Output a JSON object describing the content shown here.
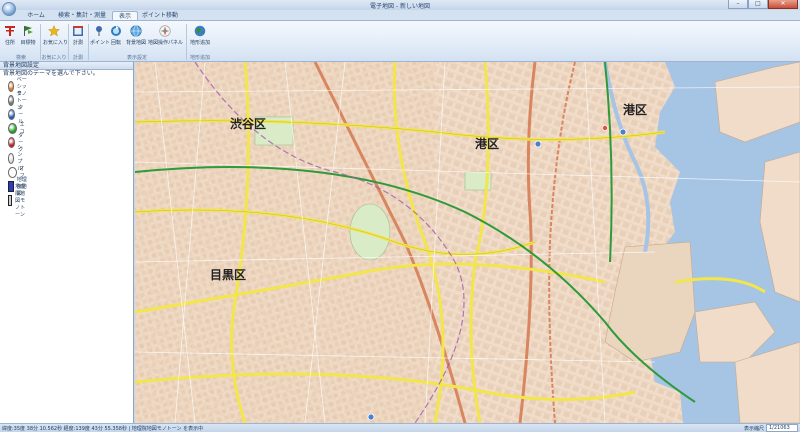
{
  "window": {
    "title": "電子地図 - 新しい地図",
    "minimize": "–",
    "maximize": "□",
    "close": "✕"
  },
  "tabs": [
    {
      "label": "ホーム"
    },
    {
      "label": "検索・集計・測量"
    },
    {
      "label": "表示"
    },
    {
      "label": "ポイント移動"
    }
  ],
  "ribbon": {
    "buttons": [
      {
        "label": "住所",
        "icon": "pin-icon",
        "color": "#c4271b"
      },
      {
        "label": "目標物",
        "icon": "flag-icon",
        "color": "#2f7d2f"
      },
      {
        "label": "お気に入り",
        "icon": "star-icon",
        "color": "#e8b81e"
      },
      {
        "label": "計測",
        "icon": "ruler-icon",
        "color": "#3b6cb0"
      },
      {
        "label": "ポイント",
        "icon": "pushpin-icon",
        "color": "#3b6cb0"
      },
      {
        "label": "回転",
        "icon": "rotate-icon",
        "color": "#2e7bc4"
      },
      {
        "label": "背景地図",
        "icon": "globe-icon",
        "color": "#2e7bc4"
      },
      {
        "label": "地図操作パネル",
        "icon": "compass-icon",
        "color": "#c04a3a"
      },
      {
        "label": "地形追加",
        "icon": "earth-icon",
        "color": "#3a8a3a"
      }
    ],
    "groups": [
      {
        "label": "検索"
      },
      {
        "label": "お気に入り"
      },
      {
        "label": "計測"
      },
      {
        "label": "表示設定"
      },
      {
        "label": "地形追加"
      }
    ]
  },
  "panel": {
    "title": "背景地図設定",
    "prompt": "背景地図のテーマを選んで下さい。",
    "styles": [
      {
        "label": "ベーシック",
        "color": "#e07a2a",
        "shape": "dot"
      },
      {
        "label": "モノトーン",
        "color": "#777777",
        "shape": "dot"
      },
      {
        "label": "クール",
        "color": "#1f5fbf",
        "shape": "dot"
      },
      {
        "label": "エコ",
        "color": "#22a022",
        "shape": "dot"
      },
      {
        "label": "ダーク",
        "color": "#c81e1e",
        "shape": "dot"
      },
      {
        "label": "シンプル",
        "color": "#dddddd",
        "shape": "dot"
      },
      {
        "label": "オフ",
        "color": "#ffffff",
        "shape": "dot"
      },
      {
        "label": "地理院地図",
        "color": "#2a3fbf",
        "shape": "sq"
      },
      {
        "label": "地理院地図モノトーン",
        "color": "#cfcfcf",
        "shape": "sq"
      }
    ]
  },
  "map": {
    "labels": [
      {
        "text": "渋谷区"
      },
      {
        "text": "港区"
      },
      {
        "text": "港区"
      },
      {
        "text": "目黒区"
      }
    ],
    "colors": {
      "land": "#f0dcc9",
      "water": "#a6c4e3",
      "park": "#d9ecc7",
      "road_major": "#f2e64a",
      "road_rail": "#d9855f"
    }
  },
  "status": {
    "text": "緯度:35度 38分 10.562秒 経度:139度 43分 55.358秒 | 地理院地図モノトーン を表示中",
    "zoom_label": "表示縮尺",
    "scale": "1/21063"
  }
}
